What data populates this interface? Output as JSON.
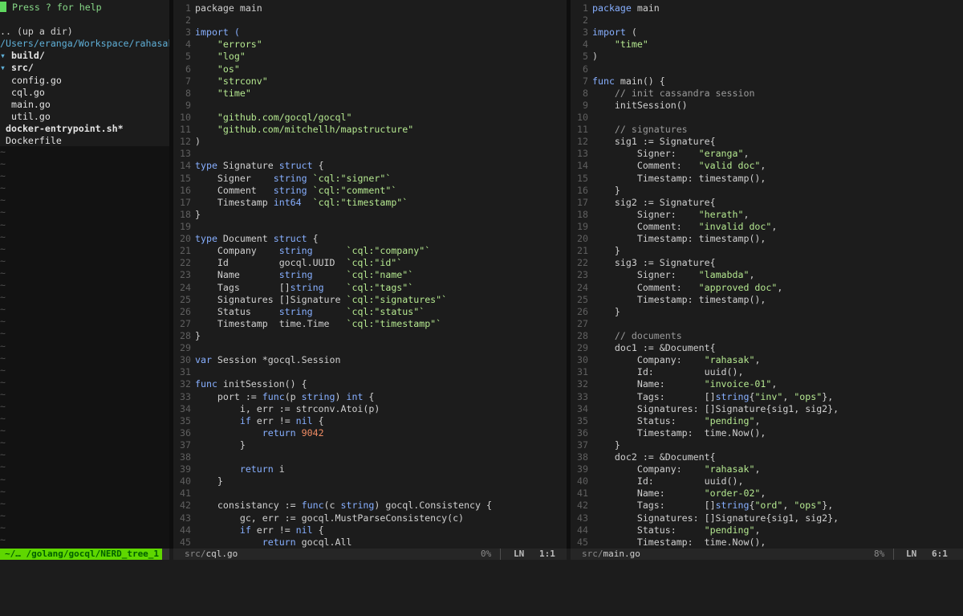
{
  "nerdtree": {
    "help": " Press ? for help",
    "up_dir": ".. (up a dir)",
    "path": "/Users/eranga/Workspace/rahasak",
    "items": [
      {
        "arrow": "▾ ",
        "name": "build/",
        "kind": "dir",
        "indent": 0
      },
      {
        "arrow": "▾ ",
        "name": "src/",
        "kind": "dir",
        "indent": 0
      },
      {
        "arrow": "",
        "name": "config.go",
        "kind": "file",
        "indent": 2
      },
      {
        "arrow": "",
        "name": "cql.go",
        "kind": "file",
        "indent": 2
      },
      {
        "arrow": "",
        "name": "main.go",
        "kind": "file",
        "indent": 2
      },
      {
        "arrow": "",
        "name": "util.go",
        "kind": "file",
        "indent": 2
      },
      {
        "arrow": "",
        "name": "docker-entrypoint.sh*",
        "kind": "exec",
        "indent": 1
      },
      {
        "arrow": "",
        "name": "Dockerfile",
        "kind": "file",
        "indent": 1
      }
    ],
    "empty_marker": "~"
  },
  "statusbar": {
    "tree_mode": "~/… /golang/gocql/NERD_tree_1",
    "left": {
      "dir": "src/",
      "file": "cql.go",
      "percent": "0%",
      "ln_label": "LN",
      "position": "1:1"
    },
    "right": {
      "dir": "src/",
      "file": "main.go",
      "percent": "8%",
      "ln_label": "LN",
      "position": "6:1"
    }
  },
  "colors": {
    "keyword": "#87afff",
    "string": "#b5e890",
    "number": "#f08c64",
    "comment": "#9a9a9a",
    "mode_green": "#5fd700"
  },
  "left_code": [
    [
      [
        "package main"
      ]
    ],
    [],
    [
      [
        "import (",
        "kw"
      ]
    ],
    [
      [
        "    "
      ],
      [
        "\"errors\"",
        "str"
      ]
    ],
    [
      [
        "    "
      ],
      [
        "\"log\"",
        "str"
      ]
    ],
    [
      [
        "    "
      ],
      [
        "\"os\"",
        "str"
      ]
    ],
    [
      [
        "    "
      ],
      [
        "\"strconv\"",
        "str"
      ]
    ],
    [
      [
        "    "
      ],
      [
        "\"time\"",
        "str"
      ]
    ],
    [],
    [
      [
        "    "
      ],
      [
        "\"github.com/gocql/gocql\"",
        "str"
      ]
    ],
    [
      [
        "    "
      ],
      [
        "\"github.com/mitchellh/mapstructure\"",
        "str"
      ]
    ],
    [
      [
        ")"
      ]
    ],
    [],
    [
      [
        "type",
        "kw"
      ],
      [
        " Signature "
      ],
      [
        "struct",
        "kw"
      ],
      [
        " {"
      ]
    ],
    [
      [
        "    Signer    "
      ],
      [
        "string",
        "kw"
      ],
      [
        " "
      ],
      [
        "`cql:\"signer\"`",
        "str"
      ]
    ],
    [
      [
        "    Comment   "
      ],
      [
        "string",
        "kw"
      ],
      [
        " "
      ],
      [
        "`cql:\"comment\"`",
        "str"
      ]
    ],
    [
      [
        "    Timestamp "
      ],
      [
        "int64",
        "kw"
      ],
      [
        "  "
      ],
      [
        "`cql:\"timestamp\"`",
        "str"
      ]
    ],
    [
      [
        "}"
      ]
    ],
    [],
    [
      [
        "type",
        "kw"
      ],
      [
        " Document "
      ],
      [
        "struct",
        "kw"
      ],
      [
        " {"
      ]
    ],
    [
      [
        "    Company    "
      ],
      [
        "string",
        "kw"
      ],
      [
        "      "
      ],
      [
        "`cql:\"company\"`",
        "str"
      ]
    ],
    [
      [
        "    Id         gocql.UUID  "
      ],
      [
        "`cql:\"id\"`",
        "str"
      ]
    ],
    [
      [
        "    Name       "
      ],
      [
        "string",
        "kw"
      ],
      [
        "      "
      ],
      [
        "`cql:\"name\"`",
        "str"
      ]
    ],
    [
      [
        "    Tags       []"
      ],
      [
        "string",
        "kw"
      ],
      [
        "    "
      ],
      [
        "`cql:\"tags\"`",
        "str"
      ]
    ],
    [
      [
        "    Signatures []Signature "
      ],
      [
        "`cql:\"signatures\"`",
        "str"
      ]
    ],
    [
      [
        "    Status     "
      ],
      [
        "string",
        "kw"
      ],
      [
        "      "
      ],
      [
        "`cql:\"status\"`",
        "str"
      ]
    ],
    [
      [
        "    Timestamp  time.Time   "
      ],
      [
        "`cql:\"timestamp\"`",
        "str"
      ]
    ],
    [
      [
        "}"
      ]
    ],
    [],
    [
      [
        "var",
        "kw"
      ],
      [
        " Session *gocql.Session"
      ]
    ],
    [],
    [
      [
        "func",
        "kw"
      ],
      [
        " initSession() {"
      ]
    ],
    [
      [
        "    port := "
      ],
      [
        "func",
        "kw"
      ],
      [
        "(p "
      ],
      [
        "string",
        "kw"
      ],
      [
        ") "
      ],
      [
        "int",
        "kw"
      ],
      [
        " {"
      ]
    ],
    [
      [
        "        i, err := strconv.Atoi(p)"
      ]
    ],
    [
      [
        "        "
      ],
      [
        "if",
        "kw"
      ],
      [
        " err != "
      ],
      [
        "nil",
        "kw"
      ],
      [
        " {"
      ]
    ],
    [
      [
        "            "
      ],
      [
        "return",
        "kw"
      ],
      [
        " "
      ],
      [
        "9042",
        "num"
      ]
    ],
    [
      [
        "        }"
      ]
    ],
    [],
    [
      [
        "        "
      ],
      [
        "return",
        "kw"
      ],
      [
        " i"
      ]
    ],
    [
      [
        "    }"
      ]
    ],
    [],
    [
      [
        "    consistancy := "
      ],
      [
        "func",
        "kw"
      ],
      [
        "(c "
      ],
      [
        "string",
        "kw"
      ],
      [
        ") gocql.Consistency {"
      ]
    ],
    [
      [
        "        gc, err := gocql.MustParseConsistency(c)"
      ]
    ],
    [
      [
        "        "
      ],
      [
        "if",
        "kw"
      ],
      [
        " err != "
      ],
      [
        "nil",
        "kw"
      ],
      [
        " {"
      ]
    ],
    [
      [
        "            "
      ],
      [
        "return",
        "kw"
      ],
      [
        " gocql.All"
      ]
    ]
  ],
  "right_code": [
    [
      [
        "package",
        "kw"
      ],
      [
        " main"
      ]
    ],
    [],
    [
      [
        "import",
        "kw"
      ],
      [
        " ("
      ]
    ],
    [
      [
        "    "
      ],
      [
        "\"time\"",
        "str"
      ]
    ],
    [
      [
        ")"
      ]
    ],
    [],
    [
      [
        "func",
        "kw"
      ],
      [
        " main() {"
      ]
    ],
    [
      [
        "    "
      ],
      [
        "// init cassandra session",
        "cm"
      ]
    ],
    [
      [
        "    initSession()"
      ]
    ],
    [],
    [
      [
        "    "
      ],
      [
        "// signatures",
        "cm"
      ]
    ],
    [
      [
        "    sig1 := Signature{"
      ]
    ],
    [
      [
        "        Signer:    "
      ],
      [
        "\"eranga\"",
        "str"
      ],
      [
        ","
      ]
    ],
    [
      [
        "        Comment:   "
      ],
      [
        "\"valid doc\"",
        "str"
      ],
      [
        ","
      ]
    ],
    [
      [
        "        Timestamp: timestamp(),"
      ]
    ],
    [
      [
        "    }"
      ]
    ],
    [
      [
        "    sig2 := Signature{"
      ]
    ],
    [
      [
        "        Signer:    "
      ],
      [
        "\"herath\"",
        "str"
      ],
      [
        ","
      ]
    ],
    [
      [
        "        Comment:   "
      ],
      [
        "\"invalid doc\"",
        "str"
      ],
      [
        ","
      ]
    ],
    [
      [
        "        Timestamp: timestamp(),"
      ]
    ],
    [
      [
        "    }"
      ]
    ],
    [
      [
        "    sig3 := Signature{"
      ]
    ],
    [
      [
        "        Signer:    "
      ],
      [
        "\"lamabda\"",
        "str"
      ],
      [
        ","
      ]
    ],
    [
      [
        "        Comment:   "
      ],
      [
        "\"approved doc\"",
        "str"
      ],
      [
        ","
      ]
    ],
    [
      [
        "        Timestamp: timestamp(),"
      ]
    ],
    [
      [
        "    }"
      ]
    ],
    [],
    [
      [
        "    "
      ],
      [
        "// documents",
        "cm"
      ]
    ],
    [
      [
        "    doc1 := &Document{"
      ]
    ],
    [
      [
        "        Company:    "
      ],
      [
        "\"rahasak\"",
        "str"
      ],
      [
        ","
      ]
    ],
    [
      [
        "        Id:         uuid(),"
      ]
    ],
    [
      [
        "        Name:       "
      ],
      [
        "\"invoice-01\"",
        "str"
      ],
      [
        ","
      ]
    ],
    [
      [
        "        Tags:       []"
      ],
      [
        "string",
        "kw"
      ],
      [
        "{"
      ],
      [
        "\"inv\"",
        "str"
      ],
      [
        ", "
      ],
      [
        "\"ops\"",
        "str"
      ],
      [
        "},"
      ]
    ],
    [
      [
        "        Signatures: []Signature{sig1, sig2},"
      ]
    ],
    [
      [
        "        Status:     "
      ],
      [
        "\"pending\"",
        "str"
      ],
      [
        ","
      ]
    ],
    [
      [
        "        Timestamp:  time.Now(),"
      ]
    ],
    [
      [
        "    }"
      ]
    ],
    [
      [
        "    doc2 := &Document{"
      ]
    ],
    [
      [
        "        Company:    "
      ],
      [
        "\"rahasak\"",
        "str"
      ],
      [
        ","
      ]
    ],
    [
      [
        "        Id:         uuid(),"
      ]
    ],
    [
      [
        "        Name:       "
      ],
      [
        "\"order-02\"",
        "str"
      ],
      [
        ","
      ]
    ],
    [
      [
        "        Tags:       []"
      ],
      [
        "string",
        "kw"
      ],
      [
        "{"
      ],
      [
        "\"ord\"",
        "str"
      ],
      [
        ", "
      ],
      [
        "\"ops\"",
        "str"
      ],
      [
        "},"
      ]
    ],
    [
      [
        "        Signatures: []Signature{sig1, sig2},"
      ]
    ],
    [
      [
        "        Status:     "
      ],
      [
        "\"pending\"",
        "str"
      ],
      [
        ","
      ]
    ],
    [
      [
        "        Timestamp:  time.Now(),"
      ]
    ]
  ]
}
